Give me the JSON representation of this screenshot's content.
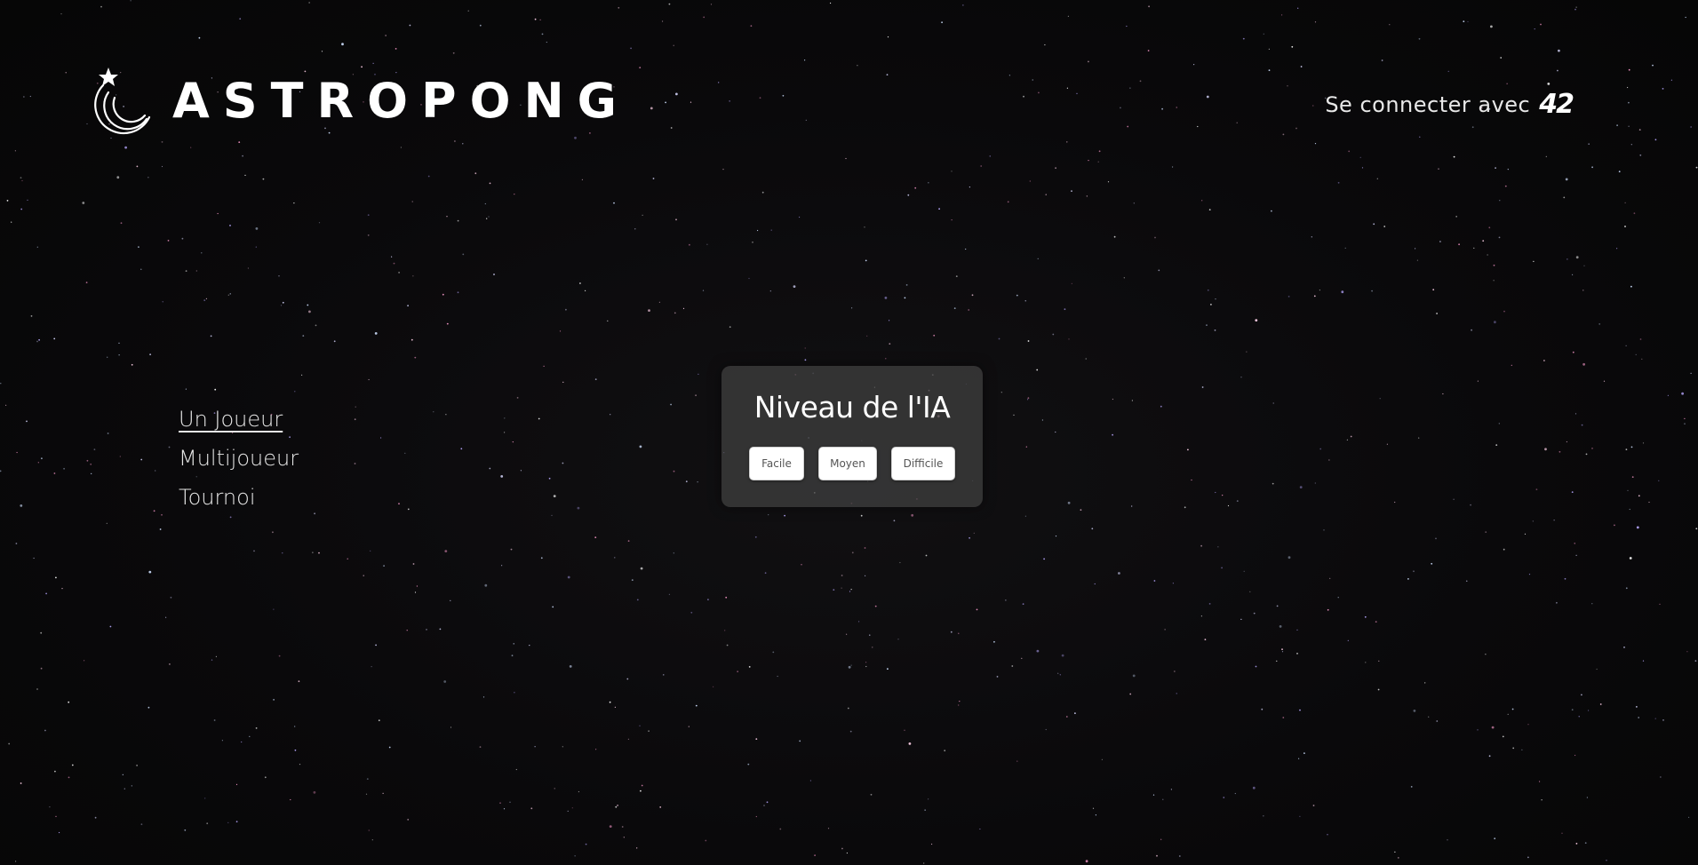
{
  "header": {
    "logo_text": "ASTROPONG",
    "login_label": "Se connecter avec",
    "login_brand": "42"
  },
  "menu": {
    "items": [
      {
        "label": "Un Joueur",
        "active": true
      },
      {
        "label": "Multijoueur",
        "active": false
      },
      {
        "label": "Tournoi",
        "active": false
      }
    ]
  },
  "ai_panel": {
    "title": "Niveau de l'IA",
    "buttons": [
      "Facile",
      "Moyen",
      "Difficile"
    ]
  },
  "colors": {
    "background": "#060606",
    "text": "#f2f2f2",
    "panel": "#3e3e3e",
    "button_bg": "#ffffff",
    "button_text": "#555555"
  },
  "icons": {
    "logo": "shooting-star-logo-icon"
  }
}
